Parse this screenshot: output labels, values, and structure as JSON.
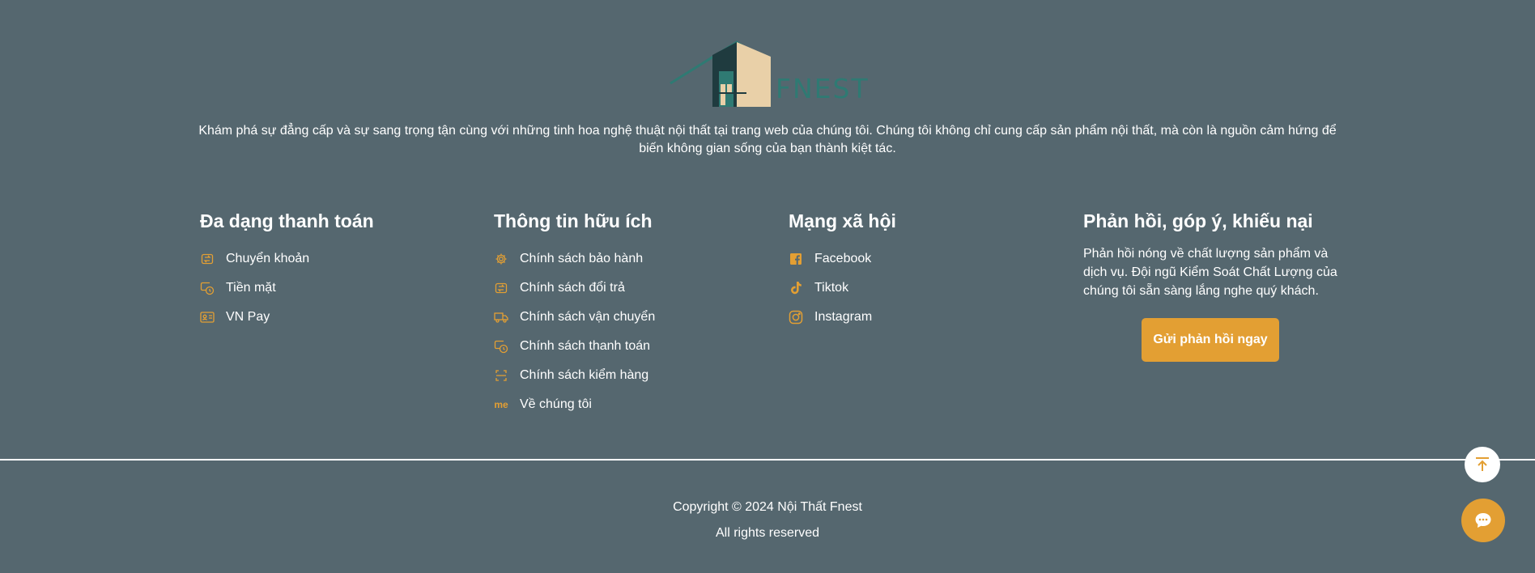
{
  "brand": {
    "logo_text": "FNEST"
  },
  "intro": "Khám phá sự đẳng cấp và sự sang trọng tận cùng với những tinh hoa nghệ thuật nội thất tại trang web của chúng tôi. Chúng tôi không chỉ cung cấp sản phẩm nội thất, mà còn là nguồn cảm hứng để biến không gian sống của bạn thành kiệt tác.",
  "payment": {
    "title": "Đa dạng thanh toán",
    "items": [
      {
        "label": "Chuyển khoản",
        "icon": "transfer-icon"
      },
      {
        "label": "Tiền mặt",
        "icon": "cash-icon"
      },
      {
        "label": "VN Pay",
        "icon": "card-icon"
      }
    ]
  },
  "info": {
    "title": "Thông tin hữu ích",
    "items": [
      {
        "label": "Chính sách bảo hành",
        "icon": "gear-icon"
      },
      {
        "label": "Chính sách đổi trả",
        "icon": "transfer-icon"
      },
      {
        "label": "Chính sách vận chuyển",
        "icon": "truck-icon"
      },
      {
        "label": "Chính sách thanh toán",
        "icon": "cash-icon"
      },
      {
        "label": "Chính sách kiểm hàng",
        "icon": "scan-icon"
      },
      {
        "label": "Về chúng tôi",
        "icon": "me-icon",
        "icon_text": "me"
      }
    ]
  },
  "social": {
    "title": "Mạng xã hội",
    "items": [
      {
        "label": "Facebook",
        "icon": "facebook-icon"
      },
      {
        "label": "Tiktok",
        "icon": "tiktok-icon"
      },
      {
        "label": "Instagram",
        "icon": "instagram-icon"
      }
    ]
  },
  "feedback": {
    "title": "Phản hồi, góp ý, khiếu nại",
    "text": "Phản hồi nóng về chất lượng sản phẩm và dịch vụ. Đội ngũ Kiểm Soát Chất Lượng của chúng tôi sẵn sàng lắng nghe quý khách.",
    "button": "Gửi phản hồi ngay"
  },
  "footer": {
    "copyright": "Copyright © 2024 Nội Thất Fnest",
    "rights": "All rights reserved"
  },
  "colors": {
    "background": "#55676f",
    "accent": "#e39f33",
    "logo_teal": "#2f7a73"
  }
}
